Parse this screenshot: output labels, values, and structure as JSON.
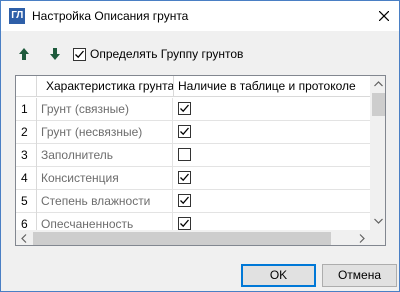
{
  "window": {
    "title": "Настройка Описания грунта",
    "app_icon_text": "ГЛ"
  },
  "toolbar": {
    "move_up_icon": "arrow-up-icon",
    "move_down_icon": "arrow-down-icon",
    "group_checkbox_label": "Определять Группу грунтов",
    "group_checkbox_checked": true
  },
  "table": {
    "columns": [
      "",
      "Характеристика грунта",
      "Наличие в таблице и протоколе"
    ],
    "rows": [
      {
        "num": "1",
        "name": "Грунт (связные)",
        "checked": true
      },
      {
        "num": "2",
        "name": "Грунт (несвязные)",
        "checked": true
      },
      {
        "num": "3",
        "name": "Заполнитель",
        "checked": false
      },
      {
        "num": "4",
        "name": "Консистенция",
        "checked": true
      },
      {
        "num": "5",
        "name": "Степень влажности",
        "checked": true
      },
      {
        "num": "6",
        "name": "Опесчаненность",
        "checked": true
      }
    ]
  },
  "buttons": {
    "ok": "OK",
    "cancel": "Отмена"
  },
  "colors": {
    "accent": "#0078d7",
    "arrow_icon": "#1e5a3c",
    "app_icon_bg": "#2e5fa8"
  }
}
